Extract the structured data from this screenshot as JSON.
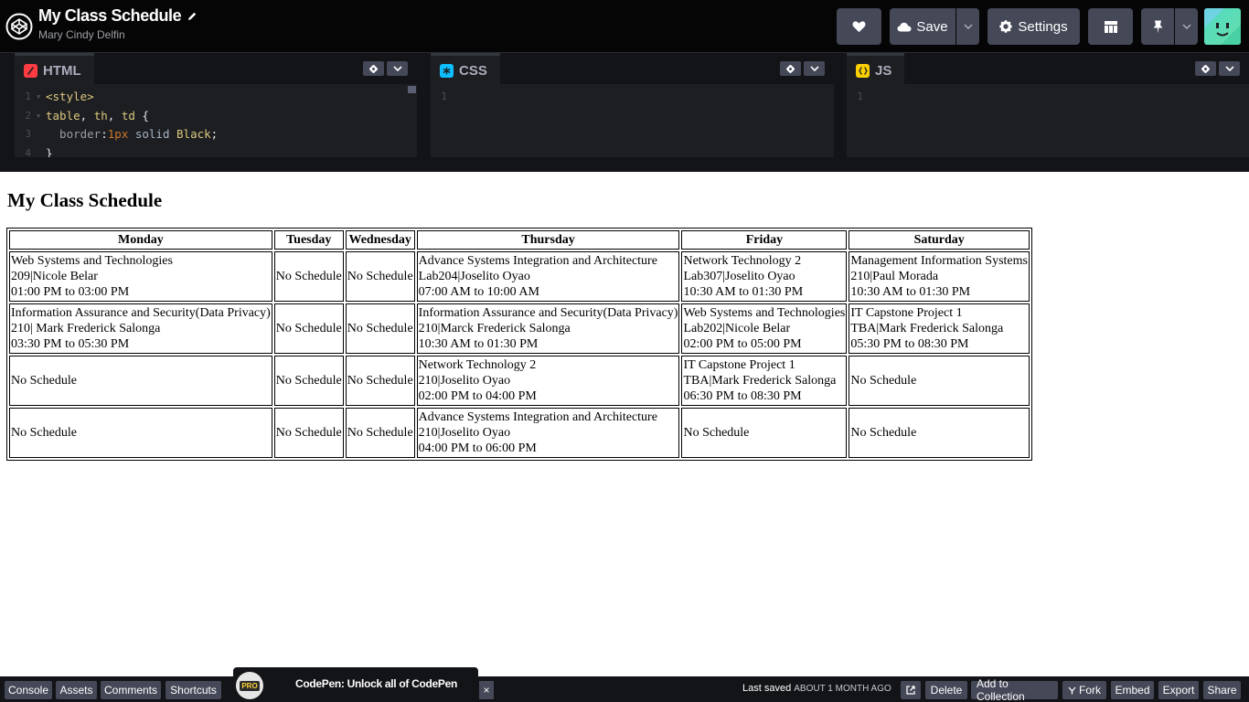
{
  "header": {
    "pen_title": "My Class Schedule",
    "author": "Mary Cindy Delfin",
    "save_label": "Save",
    "settings_label": "Settings"
  },
  "editors": {
    "html": {
      "label": "HTML",
      "lines": [
        {
          "n": "1",
          "parts": [
            {
              "t": "<style>",
              "c": "tok-tag"
            }
          ]
        },
        {
          "n": "2",
          "parts": [
            {
              "t": "table",
              "c": "tok-sel"
            },
            {
              "t": ", ",
              "c": "tok-punc"
            },
            {
              "t": "th",
              "c": "tok-sel"
            },
            {
              "t": ", ",
              "c": "tok-punc"
            },
            {
              "t": "td",
              "c": "tok-sel"
            },
            {
              "t": " {",
              "c": "tok-punc"
            }
          ]
        },
        {
          "n": "3",
          "parts": [
            {
              "t": "  border",
              "c": "tok-prop"
            },
            {
              "t": ":",
              "c": "tok-punc"
            },
            {
              "t": "1px",
              "c": "tok-num"
            },
            {
              "t": " solid ",
              "c": "tok-val"
            },
            {
              "t": "Black",
              "c": "tok-kw"
            },
            {
              "t": ";",
              "c": "tok-punc"
            }
          ]
        },
        {
          "n": "4",
          "parts": [
            {
              "t": "}",
              "c": "tok-punc"
            }
          ]
        }
      ]
    },
    "css": {
      "label": "CSS",
      "line_number": "1"
    },
    "js": {
      "label": "JS",
      "line_number": "1"
    }
  },
  "preview": {
    "heading": "My Class Schedule",
    "columns": [
      "Monday",
      "Tuesday",
      "Wednesday",
      "Thursday",
      "Friday",
      "Saturday"
    ],
    "rows": [
      [
        [
          "Web Systems and Technologies",
          "209|Nicole Belar",
          "01:00 PM to 03:00 PM"
        ],
        [
          "No Schedule"
        ],
        [
          "No Schedule"
        ],
        [
          "Advance Systems Integration and Architecture",
          "Lab204|Joselito Oyao",
          "07:00 AM to 10:00 AM"
        ],
        [
          "Network Technology 2",
          "Lab307|Joselito Oyao",
          "10:30 AM to 01:30 PM"
        ],
        [
          "Management Information Systems",
          "210|Paul Morada",
          "10:30 AM to 01:30 PM"
        ]
      ],
      [
        [
          "Information Assurance and Security(Data Privacy)",
          "210| Mark Frederick Salonga",
          "03:30 PM to 05:30 PM"
        ],
        [
          "No Schedule"
        ],
        [
          "No Schedule"
        ],
        [
          "Information Assurance and Security(Data Privacy)",
          "210|Marck Frederick Salonga",
          "10:30 AM to 01:30 PM"
        ],
        [
          "Web Systems and Technologies",
          "Lab202|Nicole Belar",
          "02:00 PM to 05:00 PM"
        ],
        [
          "IT Capstone Project 1",
          "TBA|Mark Frederick Salonga",
          "05:30 PM to 08:30 PM"
        ]
      ],
      [
        [
          "No Schedule"
        ],
        [
          "No Schedule"
        ],
        [
          "No Schedule"
        ],
        [
          "Network Technology 2",
          "210|Joselito Oyao",
          "02:00 PM to 04:00 PM"
        ],
        [
          "IT Capstone Project 1",
          "TBA|Mark Frederick Salonga",
          "06:30 PM to 08:30 PM"
        ],
        [
          "No Schedule"
        ]
      ],
      [
        [
          "No Schedule"
        ],
        [
          "No Schedule"
        ],
        [
          "No Schedule"
        ],
        [
          "Advance Systems Integration and Architecture",
          "210|Joselito Oyao",
          "04:00 PM to 06:00 PM"
        ],
        [
          "No Schedule"
        ],
        [
          "No Schedule"
        ]
      ]
    ]
  },
  "bottom_bar": {
    "left_buttons": [
      "Console",
      "Assets",
      "Comments",
      "Shortcuts"
    ],
    "promo_badge": "PRO",
    "promo_text": "CodePen: Unlock all of CodePen",
    "promo_close": "×",
    "last_saved_label": "Last saved",
    "last_saved_value": "ABOUT 1 MONTH AGO",
    "right_buttons": [
      "Delete",
      "Add to Collection",
      "Fork",
      "Embed",
      "Export",
      "Share"
    ]
  },
  "icons": {
    "logo": "codepen-logo-icon",
    "pencil": "pencil-icon",
    "heart": "heart-icon",
    "cloud": "cloud-icon",
    "gear": "gear-icon",
    "layout": "layout-grid-icon",
    "pin": "pin-icon",
    "chevron": "chevron-down-icon",
    "external": "external-link-icon",
    "fork": "fork-icon"
  },
  "colors": {
    "header_bg": "#050505",
    "button_bg": "#444857",
    "html_icon": "#ff3c41",
    "css_icon": "#0ebeff",
    "js_icon": "#fcd000"
  }
}
